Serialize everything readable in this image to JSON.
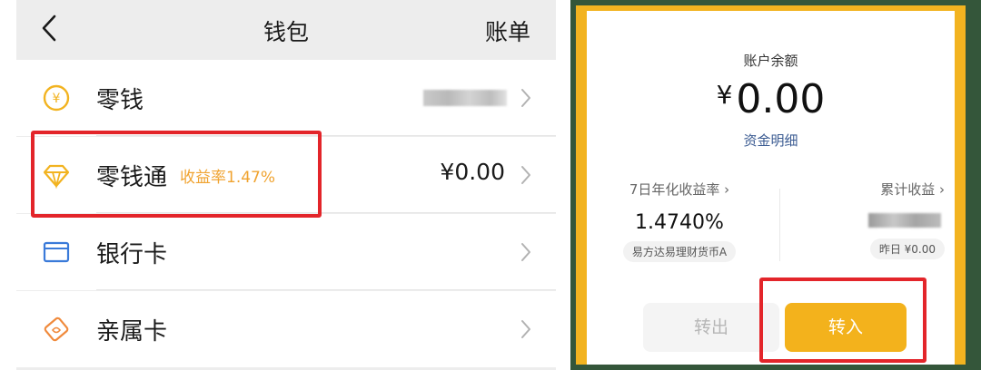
{
  "wallet": {
    "title": "钱包",
    "bill_label": "账单",
    "rows": [
      {
        "label": "零钱",
        "value": "",
        "icon": "yen-coin-icon"
      },
      {
        "label": "零钱通",
        "tag": "收益率1.47%",
        "value": "¥0.00",
        "icon": "diamond-icon"
      },
      {
        "label": "银行卡",
        "value": "",
        "icon": "bank-card-icon"
      },
      {
        "label": "亲属卡",
        "value": "",
        "icon": "family-card-icon"
      }
    ]
  },
  "detail": {
    "balance_label": "账户余额",
    "currency": "¥",
    "balance": "0.00",
    "details_link": "资金明细",
    "yield_label": "7日年化收益率 ›",
    "yield_value": "1.4740%",
    "fund_name": "易方达易理财货币A",
    "cumulative_label": "累计收益 ›",
    "yesterday": "昨日 ¥0.00",
    "transfer_out": "转出",
    "transfer_in": "转入"
  },
  "colors": {
    "accent_orange": "#f0a330",
    "highlight_red": "#e3252a",
    "button_yellow": "#f3b21c",
    "link_blue": "#3b5b92",
    "frame_green": "#34563a"
  }
}
